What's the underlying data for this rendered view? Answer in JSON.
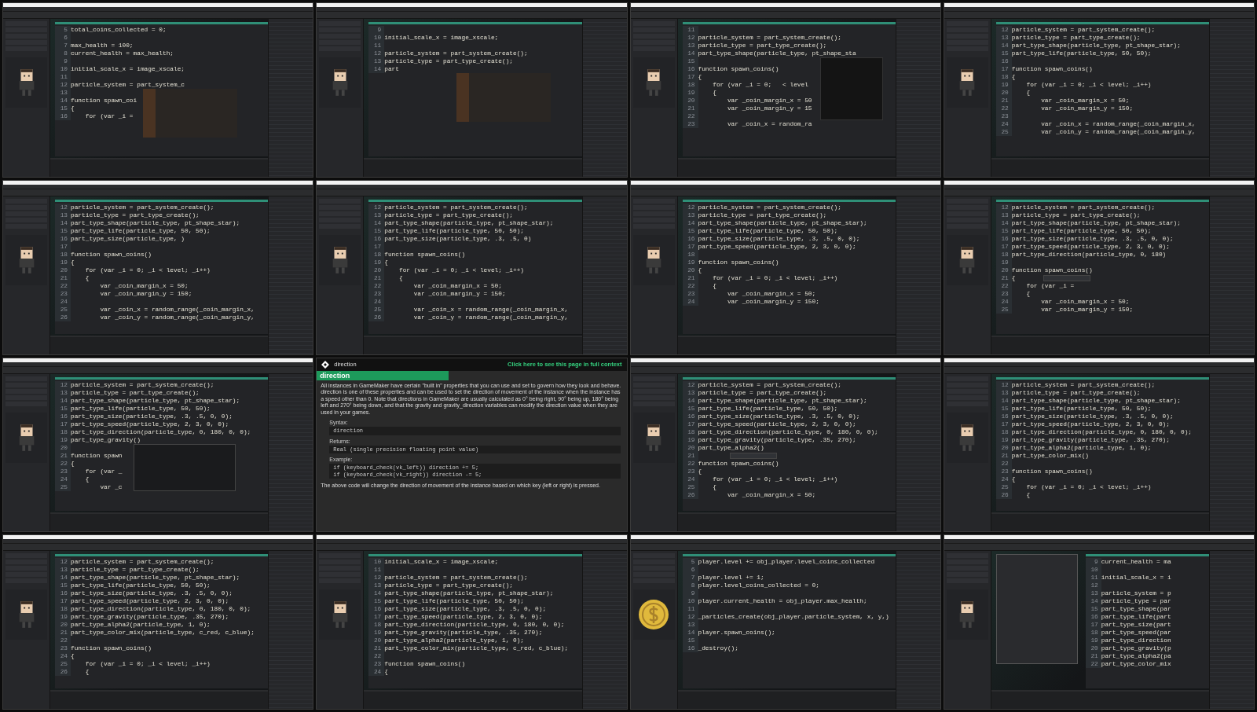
{
  "frames": [
    {
      "kind": "ide",
      "preview": {
        "kind": "character"
      },
      "code": [
        {
          "n": "5",
          "text": "total_coins_collected = 0;"
        },
        {
          "n": "6"
        },
        {
          "n": "7",
          "text": "max_health = 100;"
        },
        {
          "n": "8",
          "text": "current_health = max_health;"
        },
        {
          "n": "9"
        },
        {
          "n": "10",
          "text": "initial_scale_x = image_xscale;"
        },
        {
          "n": "11"
        },
        {
          "n": "12",
          "text": "particle_system = part_system_c",
          "popup": {
            "kind": "autocomplete"
          }
        },
        {
          "n": "13"
        },
        {
          "n": "14",
          "text": "function spawn_coi"
        },
        {
          "n": "15",
          "text": "{"
        },
        {
          "n": "16",
          "text": "    for (var _i ="
        }
      ]
    },
    {
      "kind": "ide",
      "preview": {
        "kind": "character"
      },
      "code": [
        {
          "n": "9"
        },
        {
          "n": "10",
          "text": "initial_scale_x = image_xscale;"
        },
        {
          "n": "11"
        },
        {
          "n": "12",
          "text": "particle_system = part_system_create();"
        },
        {
          "n": "13",
          "text": "particle_type = part_type_create();"
        },
        {
          "n": "14",
          "text": "part",
          "popup": {
            "kind": "autocomplete"
          }
        }
      ]
    },
    {
      "kind": "ide",
      "preview": {
        "kind": "character"
      },
      "code": [
        {
          "n": "11"
        },
        {
          "n": "12",
          "text": "particle_system = part_system_create();"
        },
        {
          "n": "13",
          "text": "particle_type = part_type_create();"
        },
        {
          "n": "14",
          "text": "part_type_shape(particle_type, pt_shape_sta",
          "popup": {
            "kind": "panel"
          }
        },
        {
          "n": "15"
        },
        {
          "n": "16",
          "text": "function spawn_coins()"
        },
        {
          "n": "17",
          "text": "{"
        },
        {
          "n": "18",
          "text": "    for (var _i = 0;   < level"
        },
        {
          "n": "19",
          "text": "    {"
        },
        {
          "n": "20",
          "text": "        var _coin_margin_x = 50"
        },
        {
          "n": "21",
          "text": "        var _coin_margin_y = 15"
        },
        {
          "n": "22"
        },
        {
          "n": "23",
          "text": "        var _coin_x = random_ra"
        }
      ]
    },
    {
      "kind": "ide",
      "preview": {
        "kind": "character"
      },
      "code": [
        {
          "n": "12",
          "text": "particle_system = part_system_create();"
        },
        {
          "n": "13",
          "text": "particle_type = part_type_create();"
        },
        {
          "n": "14",
          "text": "part_type_shape(particle_type, pt_shape_star);"
        },
        {
          "n": "15",
          "text": "part_type_life(particle_type, 50, 50);"
        },
        {
          "n": "16"
        },
        {
          "n": "17",
          "text": "function spawn_coins()"
        },
        {
          "n": "18",
          "text": "{"
        },
        {
          "n": "19",
          "text": "    for (var _i = 0; _i < level; _i++)"
        },
        {
          "n": "20",
          "text": "    {"
        },
        {
          "n": "21",
          "text": "        var _coin_margin_x = 50;"
        },
        {
          "n": "22",
          "text": "        var _coin_margin_y = 150;"
        },
        {
          "n": "23"
        },
        {
          "n": "24",
          "text": "        var _coin_x = random_range(_coin_margin_x,"
        },
        {
          "n": "25",
          "text": "        var _coin_y = random_range(_coin_margin_y,"
        }
      ]
    },
    {
      "kind": "ide",
      "preview": {
        "kind": "character"
      },
      "code": [
        {
          "n": "12",
          "text": "particle_system = part_system_create();"
        },
        {
          "n": "13",
          "text": "particle_type = part_type_create();"
        },
        {
          "n": "14",
          "text": "part_type_shape(particle_type, pt_shape_star);"
        },
        {
          "n": "15",
          "text": "part_type_life(particle_type, 50, 50);"
        },
        {
          "n": "16",
          "text": "part_type_size(particle_type, )"
        },
        {
          "n": "17"
        },
        {
          "n": "18",
          "text": "function spawn_coins()"
        },
        {
          "n": "19",
          "text": "{"
        },
        {
          "n": "20",
          "text": "    for (var _i = 0; _i < level; _i++)"
        },
        {
          "n": "21",
          "text": "    {"
        },
        {
          "n": "22",
          "text": "        var _coin_margin_x = 50;"
        },
        {
          "n": "23",
          "text": "        var _coin_margin_y = 150;"
        },
        {
          "n": "24"
        },
        {
          "n": "25",
          "text": "        var _coin_x = random_range(_coin_margin_x,"
        },
        {
          "n": "26",
          "text": "        var _coin_y = random_range(_coin_margin_y,"
        }
      ]
    },
    {
      "kind": "ide",
      "preview": {
        "kind": "character"
      },
      "code": [
        {
          "n": "12",
          "text": "particle_system = part_system_create();"
        },
        {
          "n": "13",
          "text": "particle_type = part_type_create();"
        },
        {
          "n": "14",
          "text": "part_type_shape(particle_type, pt_shape_star);"
        },
        {
          "n": "15",
          "text": "part_type_life(particle_type, 50, 50);"
        },
        {
          "n": "16",
          "text": "part_type_size(particle_type, .3, .5, 0)"
        },
        {
          "n": "17"
        },
        {
          "n": "18",
          "text": "function spawn_coins()"
        },
        {
          "n": "19",
          "text": "{"
        },
        {
          "n": "20",
          "text": "    for (var _i = 0; _i < level; _i++)"
        },
        {
          "n": "21",
          "text": "    {"
        },
        {
          "n": "22",
          "text": "        var _coin_margin_x = 50;"
        },
        {
          "n": "23",
          "text": "        var _coin_margin_y = 150;"
        },
        {
          "n": "24"
        },
        {
          "n": "25",
          "text": "        var _coin_x = random_range(_coin_margin_x,"
        },
        {
          "n": "26",
          "text": "        var _coin_y = random_range(_coin_margin_y,"
        }
      ]
    },
    {
      "kind": "ide",
      "preview": {
        "kind": "character"
      },
      "code": [
        {
          "n": "12",
          "text": "particle_system = part_system_create();"
        },
        {
          "n": "13",
          "text": "particle_type = part_type_create();"
        },
        {
          "n": "14",
          "text": "part_type_shape(particle_type, pt_shape_star);"
        },
        {
          "n": "15",
          "text": "part_type_life(particle_type, 50, 50);"
        },
        {
          "n": "16",
          "text": "part_type_size(particle_type, .3, .5, 0, 0);"
        },
        {
          "n": "17",
          "text": "part_type_speed(particle_type, 2, 3, 0, 0);"
        },
        {
          "n": "18"
        },
        {
          "n": "19",
          "text": "function spawn_coins()"
        },
        {
          "n": "20",
          "text": "{"
        },
        {
          "n": "21",
          "text": "    for (var _i = 0; _i < level; _i++)"
        },
        {
          "n": "22",
          "text": "    {"
        },
        {
          "n": "23",
          "text": "        var _coin_margin_x = 50;"
        },
        {
          "n": "24",
          "text": "        var _coin_margin_y = 150;"
        }
      ]
    },
    {
      "kind": "ide",
      "preview": {
        "kind": "character"
      },
      "code": [
        {
          "n": "12",
          "text": "particle_system = part_system_create();"
        },
        {
          "n": "13",
          "text": "particle_type = part_type_create();"
        },
        {
          "n": "14",
          "text": "part_type_shape(particle_type, pt_shape_star);"
        },
        {
          "n": "15",
          "text": "part_type_life(particle_type, 50, 50);"
        },
        {
          "n": "16",
          "text": "part_type_size(particle_type, .3, .5, 0, 0);"
        },
        {
          "n": "17",
          "text": "part_type_speed(particle_type, 2, 3, 0, 0);"
        },
        {
          "n": "18",
          "text": "part_type_direction(particle_type, 0, 180)"
        },
        {
          "n": "19"
        },
        {
          "n": "20",
          "text": "function spawn_coins()"
        },
        {
          "n": "21",
          "text": "{",
          "popup": {
            "kind": "tooltip"
          }
        },
        {
          "n": "22",
          "text": "    for (var _i ="
        },
        {
          "n": "23",
          "text": "    {"
        },
        {
          "n": "24",
          "text": "        var _coin_margin_x = 50;"
        },
        {
          "n": "25",
          "text": "        var _coin_margin_y = 150;"
        }
      ]
    },
    {
      "kind": "ide",
      "preview": {
        "kind": "character"
      },
      "code": [
        {
          "n": "12",
          "text": "particle_system = part_system_create();"
        },
        {
          "n": "13",
          "text": "particle_type = part_type_create();"
        },
        {
          "n": "14",
          "text": "part_type_shape(particle_type, pt_shape_star);"
        },
        {
          "n": "15",
          "text": "part_type_life(particle_type, 50, 50);"
        },
        {
          "n": "16",
          "text": "part_type_size(particle_type, .3, .5, 0, 0);"
        },
        {
          "n": "17",
          "text": "part_type_speed(particle_type, 2, 3, 0, 0);"
        },
        {
          "n": "18",
          "text": "part_type_direction(particle_type, 0, 180, 0, 0);"
        },
        {
          "n": "19",
          "text": "part_type_gravity()",
          "popup": {
            "kind": "help"
          }
        },
        {
          "n": "20"
        },
        {
          "n": "21",
          "text": "function spawn"
        },
        {
          "n": "22",
          "text": "{"
        },
        {
          "n": "23",
          "text": "    for (var _"
        },
        {
          "n": "24",
          "text": "    {"
        },
        {
          "n": "25",
          "text": "        var _c"
        }
      ]
    },
    {
      "kind": "doc",
      "header": "direction",
      "link": "Click here to see this page in full context",
      "title": "direction",
      "intro": "All instances in GameMaker have certain \"built in\" properties that you can use and set to govern how they look and behave. direction is one of these properties and can be used to set the direction of movement of the instance when the instance has a speed other than 0. Note that directions in GameMaker are usually calculated as 0° being right, 90° being up, 180° being left and 270° being down, and that the gravity and gravity_direction variables can modify the direction value when they are used in your games.",
      "sections": [
        {
          "heading": "Syntax:",
          "code": [
            "direction"
          ]
        },
        {
          "heading": "Returns:",
          "code": [
            "Real (single precision floating point value)"
          ]
        },
        {
          "heading": "Example:",
          "code": [
            "if (keyboard_check(vk_left)) direction += 5;",
            "if (keyboard_check(vk_right)) direction -= 5;"
          ]
        }
      ],
      "outro": "The above code will change the direction of movement of the instance based on which key (left or right) is pressed."
    },
    {
      "kind": "ide",
      "preview": {
        "kind": "character"
      },
      "code": [
        {
          "n": "12",
          "text": "particle_system = part_system_create();"
        },
        {
          "n": "13",
          "text": "particle_type = part_type_create();"
        },
        {
          "n": "14",
          "text": "part_type_shape(particle_type, pt_shape_star);"
        },
        {
          "n": "15",
          "text": "part_type_life(particle_type, 50, 50);"
        },
        {
          "n": "16",
          "text": "part_type_size(particle_type, .3, .5, 0, 0);"
        },
        {
          "n": "17",
          "text": "part_type_speed(particle_type, 2, 3, 0, 0);"
        },
        {
          "n": "18",
          "text": "part_type_direction(particle_type, 0, 180, 0, 0);"
        },
        {
          "n": "19",
          "text": "part_type_gravity(particle_type, .35, 270);"
        },
        {
          "n": "20",
          "text": "part_type_alpha2()"
        },
        {
          "n": "21",
          "popup": {
            "kind": "tooltip"
          }
        },
        {
          "n": "22",
          "text": "function spawn_coins()"
        },
        {
          "n": "23",
          "text": "{"
        },
        {
          "n": "24",
          "text": "    for (var _i = 0; _i < level; _i++)"
        },
        {
          "n": "25",
          "text": "    {"
        },
        {
          "n": "26",
          "text": "        var _coin_margin_x = 50;"
        }
      ]
    },
    {
      "kind": "ide",
      "preview": {
        "kind": "character"
      },
      "code": [
        {
          "n": "12",
          "text": "particle_system = part_system_create();"
        },
        {
          "n": "13",
          "text": "particle_type = part_type_create();"
        },
        {
          "n": "14",
          "text": "part_type_shape(particle_type, pt_shape_star);"
        },
        {
          "n": "15",
          "text": "part_type_life(particle_type, 50, 50);"
        },
        {
          "n": "16",
          "text": "part_type_size(particle_type, .3, .5, 0, 0);"
        },
        {
          "n": "17",
          "text": "part_type_speed(particle_type, 2, 3, 0, 0);"
        },
        {
          "n": "18",
          "text": "part_type_direction(particle_type, 0, 180, 0, 0);"
        },
        {
          "n": "19",
          "text": "part_type_gravity(particle_type, .35, 270);"
        },
        {
          "n": "20",
          "text": "part_type_alpha2(particle_type, 1, 0);"
        },
        {
          "n": "21",
          "text": "part_type_color_mix()"
        },
        {
          "n": "22"
        },
        {
          "n": "23",
          "text": "function spawn_coins()"
        },
        {
          "n": "24",
          "text": "{"
        },
        {
          "n": "25",
          "text": "    for (var _i = 0; _i < level; _i++)"
        },
        {
          "n": "26",
          "text": "    {"
        }
      ]
    },
    {
      "kind": "ide",
      "preview": {
        "kind": "character"
      },
      "code": [
        {
          "n": "12",
          "text": "particle_system = part_system_create();"
        },
        {
          "n": "13",
          "text": "particle_type = part_type_create();"
        },
        {
          "n": "14",
          "text": "part_type_shape(particle_type, pt_shape_star);"
        },
        {
          "n": "15",
          "text": "part_type_life(particle_type, 50, 50);"
        },
        {
          "n": "16",
          "text": "part_type_size(particle_type, .3, .5, 0, 0);"
        },
        {
          "n": "17",
          "text": "part_type_speed(particle_type, 2, 3, 0, 0);"
        },
        {
          "n": "18",
          "text": "part_type_direction(particle_type, 0, 180, 0, 0);"
        },
        {
          "n": "19",
          "text": "part_type_gravity(particle_type, .35, 270);"
        },
        {
          "n": "20",
          "text": "part_type_alpha2(particle_type, 1, 0);"
        },
        {
          "n": "21",
          "text": "part_type_color_mix(particle_type, c_red, c_blue);"
        },
        {
          "n": "22"
        },
        {
          "n": "23",
          "text": "function spawn_coins()"
        },
        {
          "n": "24",
          "text": "{"
        },
        {
          "n": "25",
          "text": "    for (var _i = 0; _i < level; _i++)"
        },
        {
          "n": "26",
          "text": "    {"
        }
      ]
    },
    {
      "kind": "ide",
      "preview": {
        "kind": "character"
      },
      "code": [
        {
          "n": "10",
          "text": "initial_scale_x = image_xscale;"
        },
        {
          "n": "11"
        },
        {
          "n": "12",
          "text": "particle_system = part_system_create();"
        },
        {
          "n": "13",
          "text": "particle_type = part_type_create();"
        },
        {
          "n": "14",
          "text": "part_type_shape(particle_type, pt_shape_star);"
        },
        {
          "n": "15",
          "text": "part_type_life(particle_type, 50, 50);"
        },
        {
          "n": "16",
          "text": "part_type_size(particle_type, .3, .5, 0, 0);"
        },
        {
          "n": "17",
          "text": "part_type_speed(particle_type, 2, 3, 0, 0);"
        },
        {
          "n": "18",
          "text": "part_type_direction(particle_type, 0, 180, 0, 0);"
        },
        {
          "n": "19",
          "text": "part_type_gravity(particle_type, .35, 270);"
        },
        {
          "n": "20",
          "text": "part_type_alpha2(particle_type, 1, 0);"
        },
        {
          "n": "21",
          "text": "part_type_color_mix(particle_type, c_red, c_blue);"
        },
        {
          "n": "22"
        },
        {
          "n": "23",
          "text": "function spawn_coins()"
        },
        {
          "n": "24",
          "text": "{"
        }
      ]
    },
    {
      "kind": "ide",
      "preview": {
        "kind": "coin"
      },
      "code": [
        {
          "n": "5",
          "text": "player.level += obj_player.level_coins_collected"
        },
        {
          "n": "6"
        },
        {
          "n": "7",
          "text": "player.level += 1;"
        },
        {
          "n": "8",
          "text": "player.level_coins_collected = 0;"
        },
        {
          "n": "9"
        },
        {
          "n": "10",
          "text": "player.current_health = obj_player.max_health;"
        },
        {
          "n": "11"
        },
        {
          "n": "12",
          "text": "_particles_create(obj_player.particle_system, x, y,)"
        },
        {
          "n": "13"
        },
        {
          "n": "14",
          "text": "player.spawn_coins();"
        },
        {
          "n": "15"
        },
        {
          "n": "16",
          "text": "_destroy();"
        }
      ]
    },
    {
      "kind": "ide",
      "preview": {
        "kind": "character"
      },
      "overlay": {
        "kind": "menus"
      },
      "code": [
        {
          "n": "9",
          "text": "current_health = ma"
        },
        {
          "n": "10"
        },
        {
          "n": "11",
          "text": "initial_scale_x = i"
        },
        {
          "n": "12"
        },
        {
          "n": "13",
          "text": "particle_system = p"
        },
        {
          "n": "14",
          "text": "particle_type = par"
        },
        {
          "n": "15",
          "text": "part_type_shape(par"
        },
        {
          "n": "16",
          "text": "part_type_life(part"
        },
        {
          "n": "17",
          "text": "part_type_size(part"
        },
        {
          "n": "18",
          "text": "part_type_speed(par"
        },
        {
          "n": "19",
          "text": "part_type_direction"
        },
        {
          "n": "20",
          "text": "part_type_gravity(p"
        },
        {
          "n": "21",
          "text": "part_type_alpha2(pa"
        },
        {
          "n": "22",
          "text": "part_type_color_mix"
        }
      ]
    }
  ]
}
